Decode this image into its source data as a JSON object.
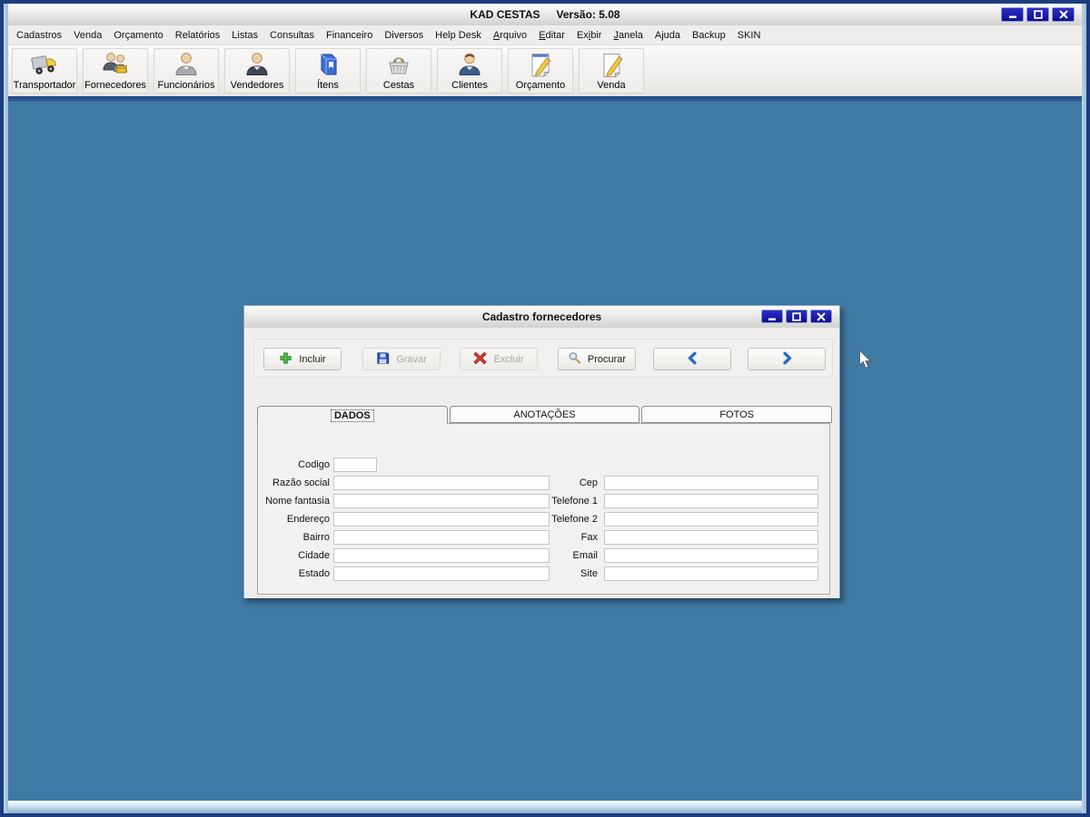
{
  "window": {
    "title": "KAD CESTAS",
    "version": "Versão: 5.08",
    "controls": [
      {
        "name": "minimize",
        "icon": "minimize-icon"
      },
      {
        "name": "maximize",
        "icon": "maximize-icon"
      },
      {
        "name": "close",
        "icon": "close-icon"
      }
    ]
  },
  "menubar": {
    "items": [
      {
        "label": "Cadastros",
        "underline": -1
      },
      {
        "label": "Venda",
        "underline": -1
      },
      {
        "label": "Orçamento",
        "underline": -1
      },
      {
        "label": "Relatórios",
        "underline": -1
      },
      {
        "label": "Listas",
        "underline": -1
      },
      {
        "label": "Consultas",
        "underline": -1
      },
      {
        "label": "Financeiro",
        "underline": -1
      },
      {
        "label": "Diversos",
        "underline": -1
      },
      {
        "label": "Help Desk",
        "underline": -1
      },
      {
        "label": "Arquivo",
        "underline": 0
      },
      {
        "label": "Editar",
        "underline": 0
      },
      {
        "label": "Exibir",
        "underline": 2
      },
      {
        "label": "Janela",
        "underline": 0
      },
      {
        "label": "Ajuda",
        "underline": -1
      },
      {
        "label": "Backup",
        "underline": -1
      },
      {
        "label": "SKIN",
        "underline": -1
      }
    ]
  },
  "toolbar": {
    "buttons": [
      {
        "label": "Transportador",
        "icon": "truck-icon"
      },
      {
        "label": "Fornecedores",
        "icon": "suppliers-people-icon"
      },
      {
        "label": "Funcionários",
        "icon": "employee-person-icon"
      },
      {
        "label": "Vendedores",
        "icon": "seller-person-icon"
      },
      {
        "label": "Ítens",
        "icon": "item-box-icon"
      },
      {
        "label": "Cestas",
        "icon": "basket-icon"
      },
      {
        "label": "Clientes",
        "icon": "client-person-icon"
      },
      {
        "label": "Orçamento",
        "icon": "budget-document-icon"
      },
      {
        "label": "Venda",
        "icon": "sale-pencil-icon"
      }
    ]
  },
  "dialog": {
    "title": "Cadastro fornecedores",
    "controls": [
      {
        "name": "minimize",
        "icon": "minimize-icon"
      },
      {
        "name": "maximize",
        "icon": "maximize-icon"
      },
      {
        "name": "close",
        "icon": "close-icon"
      }
    ],
    "actions": [
      {
        "label": "Incluir",
        "icon": "plus-icon",
        "enabled": true
      },
      {
        "label": "Gravar",
        "icon": "save-floppy-icon",
        "enabled": false
      },
      {
        "label": "Excluir",
        "icon": "delete-x-icon",
        "enabled": false
      },
      {
        "label": "Procurar",
        "icon": "search-magnifier-icon",
        "enabled": true
      },
      {
        "label": "",
        "icon": "chevron-left-icon",
        "enabled": true,
        "name": "previous-record-button"
      },
      {
        "label": "",
        "icon": "chevron-right-icon",
        "enabled": true,
        "name": "next-record-button"
      }
    ],
    "tabs": [
      {
        "label": "DADOS",
        "active": true
      },
      {
        "label": "ANOTAÇÕES",
        "active": false
      },
      {
        "label": "FOTOS",
        "active": false
      }
    ],
    "form": {
      "left_fields": [
        {
          "label": "Codigo",
          "value": ""
        },
        {
          "label": "Razão social",
          "value": ""
        },
        {
          "label": "Nome fantasia",
          "value": ""
        },
        {
          "label": "Endereço",
          "value": ""
        },
        {
          "label": "Bairro",
          "value": ""
        },
        {
          "label": "Cidade",
          "value": ""
        },
        {
          "label": "Estado",
          "value": ""
        }
      ],
      "right_fields": [
        {
          "label": "Cep",
          "value": ""
        },
        {
          "label": "Telefone 1",
          "value": ""
        },
        {
          "label": "Telefone 2",
          "value": ""
        },
        {
          "label": "Fax",
          "value": ""
        },
        {
          "label": "Email",
          "value": ""
        },
        {
          "label": "Site",
          "value": ""
        }
      ]
    }
  },
  "colors": {
    "desktop_background": "#3e7aa4",
    "frame_border": "#1c3d7d",
    "window_button_blue": "#1414a8",
    "titlebar_gradient_top": "#ffffff",
    "titlebar_gradient_bottom": "#d3d1cf",
    "enabled_icon_green": "#4db848",
    "disabled_text": "#a7a6a3",
    "chevron_blue": "#2a6fc0"
  }
}
